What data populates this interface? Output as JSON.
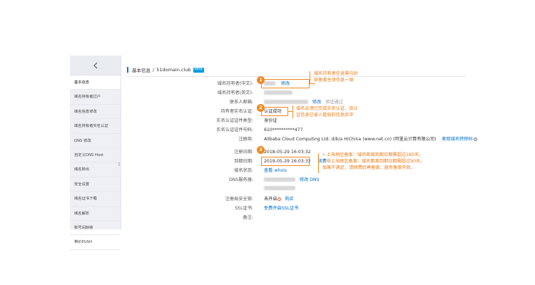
{
  "sidebar": {
    "items": [
      {
        "label": "基本信息",
        "active": true
      },
      {
        "label": "域名持有者过户"
      },
      {
        "label": "域名信息修改"
      },
      {
        "label": "域名持有者实名认证"
      },
      {
        "label": "DNS 修改"
      },
      {
        "label": "自定义DNS Host"
      },
      {
        "label": "域名转出"
      },
      {
        "label": "安全设置"
      },
      {
        "label": "域名证书下载"
      },
      {
        "label": "域名解析"
      },
      {
        "label": "账号间转移"
      },
      {
        "label": "带价PUSH"
      }
    ]
  },
  "breadcrumb": {
    "section": "基本信息",
    "sep": "/",
    "domain": "51domain.club",
    "badge": "Beta"
  },
  "fields": {
    "holder_cn": {
      "label": "域名持有者(中文):",
      "action": "修改"
    },
    "holder_en": {
      "label": "域名持有者(英文):"
    },
    "email": {
      "label": "联系人邮箱:",
      "action": "修改",
      "status": "验证通过"
    },
    "realname": {
      "label": "持有者实名认证:",
      "value": "认证成功"
    },
    "cert_type": {
      "label": "实名认证证件类型:",
      "value": "身份证"
    },
    "cert_no": {
      "label": "实名认证证件号码:",
      "value": "610**********477"
    },
    "registrar": {
      "label": "注册商:",
      "value": "Alibaba Cloud Computing Ltd. d/b/a HiChina (www.net.cn) (阿里云计算有限公司)",
      "action": "索取域名转移码"
    },
    "reg_date": {
      "label": "注册日期:",
      "value": "2018-05-29 16:03:32"
    },
    "expire_date": {
      "label": "到期日期:",
      "value": "2019-05-29 16:03:32",
      "action": "续费"
    },
    "status": {
      "label": "域名状态:",
      "action": "查看 whois"
    },
    "dns": {
      "label": "DNS服务器:",
      "action": "修改 DNS"
    },
    "lock": {
      "label": "注册局安全锁:",
      "value": "未开启",
      "action": "购买"
    },
    "ssl": {
      "label": "SSL证书:",
      "action": "免费开启SSL证书"
    },
    "remark": {
      "label": "备注:"
    }
  },
  "annotations": {
    "a1": {
      "num": "1",
      "lines": [
        "域名持有者信息需与后",
        "续备案主体信息一致"
      ]
    },
    "a2": {
      "num": "2",
      "lines": [
        "域名必须已完成实名认证，且认",
        "证信息已录入管局的信息库中"
      ]
    },
    "a3": {
      "num": "3",
      "lines": [
        "•  上海地区备案：域名距离到期日期需超过180天。",
        "•  非上海地区备案：域名距离到期日期需超过90天。",
        "如果不满足，请续费后再备案，避免备案失败。"
      ]
    }
  },
  "colors": {
    "accent": "#0070cc",
    "annotation": "#f08a24",
    "sidebar_bg": "#eef0f4"
  }
}
